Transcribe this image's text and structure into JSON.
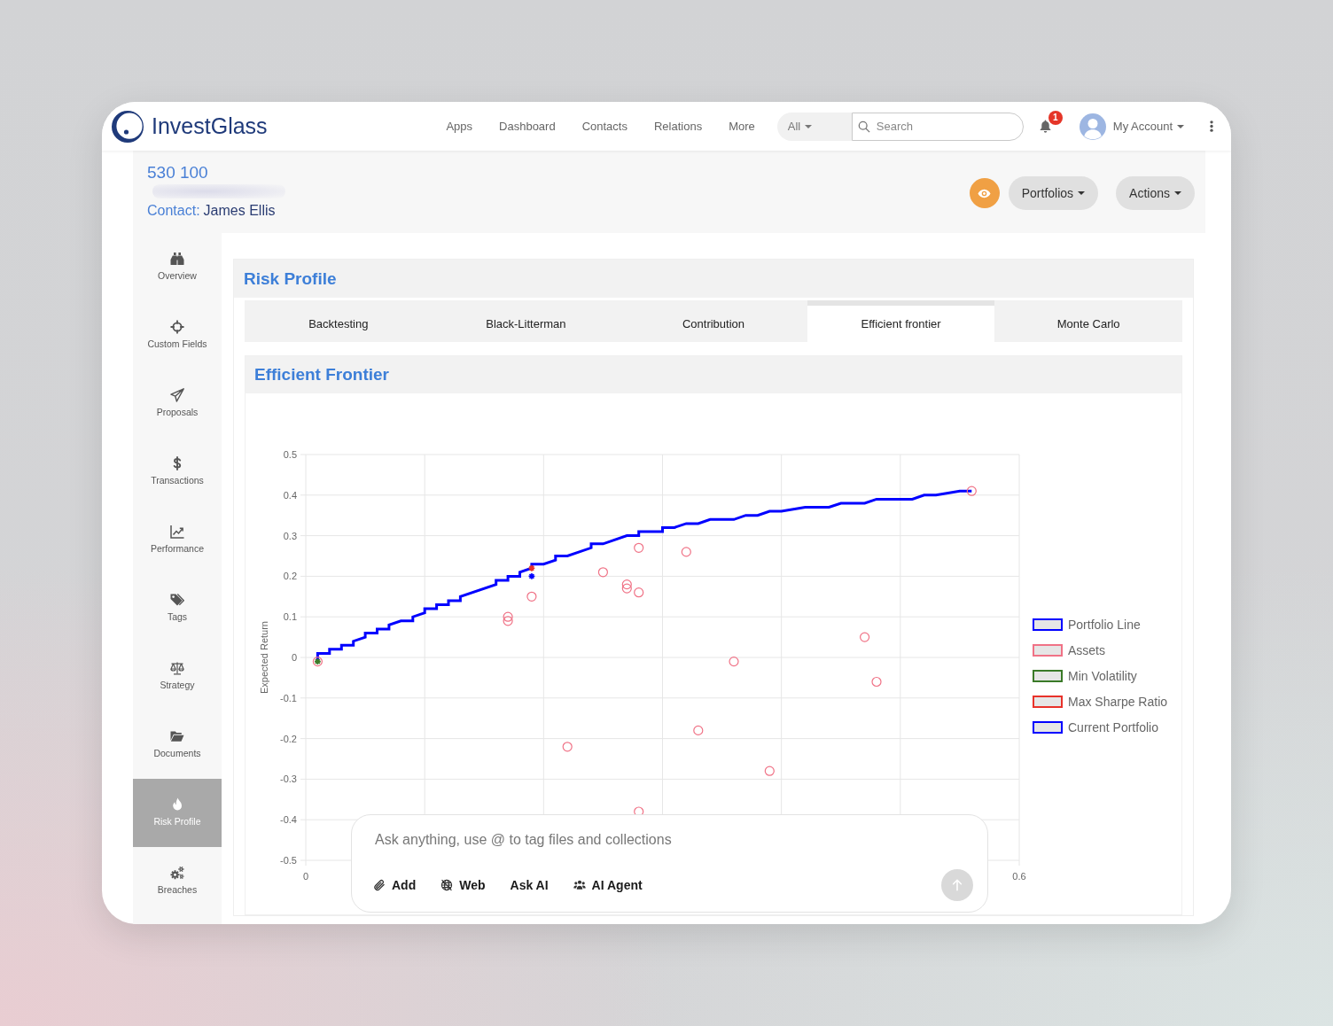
{
  "header": {
    "logo": "InvestGlass",
    "nav": [
      "Apps",
      "Dashboard",
      "Contacts",
      "Relations",
      "More"
    ],
    "search_scope": "All",
    "search": {
      "placeholder": "Search"
    },
    "notification_count": "1",
    "account": "My Account"
  },
  "record": {
    "title": "530 100",
    "contact_label": "Contact:",
    "contact_name": "James Ellis",
    "buttons": [
      "Portfolios",
      "Actions"
    ]
  },
  "sidebar": {
    "items": [
      {
        "label": "Overview",
        "selected": false
      },
      {
        "label": "Custom Fields",
        "selected": false
      },
      {
        "label": "Proposals",
        "selected": false
      },
      {
        "label": "Transactions",
        "selected": false
      },
      {
        "label": "Performance",
        "selected": false
      },
      {
        "label": "Tags",
        "selected": false
      },
      {
        "label": "Strategy",
        "selected": false
      },
      {
        "label": "Documents",
        "selected": false
      },
      {
        "label": "Risk Profile",
        "selected": true
      },
      {
        "label": "Breaches",
        "selected": false
      }
    ]
  },
  "card": {
    "title": "Risk Profile",
    "tabs": [
      {
        "label": "Backtesting",
        "selected": false
      },
      {
        "label": "Black-Litterman",
        "selected": false
      },
      {
        "label": "Contribution",
        "selected": false
      },
      {
        "label": "Efficient frontier",
        "selected": true
      },
      {
        "label": "Monte Carlo",
        "selected": false
      }
    ]
  },
  "frontier": {
    "title": "Efficient Frontier",
    "chart_data": {
      "type": "scatter",
      "ylabel": "Expected Return",
      "xlim": [
        0,
        0.6
      ],
      "ylim": [
        -0.5,
        0.5
      ],
      "xticks": [
        0,
        0.6
      ],
      "yticks": [
        0.5,
        0.4,
        0.3,
        0.2,
        0.1,
        0,
        -0.1,
        -0.2,
        -0.3,
        -0.4,
        -0.5
      ],
      "grid": true,
      "legend": "right",
      "series": [
        {
          "name": "Portfolio Line",
          "color": "#0000ff",
          "type": "line",
          "x": [
            0.01,
            0.01,
            0.02,
            0.02,
            0.03,
            0.03,
            0.04,
            0.04,
            0.05,
            0.05,
            0.06,
            0.06,
            0.07,
            0.07,
            0.08,
            0.09,
            0.09,
            0.1,
            0.1,
            0.11,
            0.11,
            0.12,
            0.12,
            0.13,
            0.13,
            0.16,
            0.16,
            0.17,
            0.17,
            0.18,
            0.18,
            0.19,
            0.19,
            0.2,
            0.21,
            0.21,
            0.22,
            0.24,
            0.24,
            0.25,
            0.27,
            0.28,
            0.28,
            0.3,
            0.3,
            0.31,
            0.32,
            0.33,
            0.34,
            0.36,
            0.37,
            0.38,
            0.39,
            0.4,
            0.42,
            0.44,
            0.45,
            0.47,
            0.48,
            0.51,
            0.52,
            0.53,
            0.55,
            0.56
          ],
          "values": [
            -0.01,
            0.01,
            0.01,
            0.02,
            0.02,
            0.03,
            0.03,
            0.04,
            0.05,
            0.06,
            0.06,
            0.07,
            0.07,
            0.08,
            0.09,
            0.09,
            0.1,
            0.11,
            0.12,
            0.12,
            0.13,
            0.13,
            0.14,
            0.14,
            0.15,
            0.18,
            0.19,
            0.19,
            0.2,
            0.2,
            0.21,
            0.22,
            0.23,
            0.23,
            0.24,
            0.25,
            0.25,
            0.27,
            0.28,
            0.28,
            0.3,
            0.3,
            0.31,
            0.31,
            0.32,
            0.32,
            0.33,
            0.33,
            0.34,
            0.34,
            0.35,
            0.35,
            0.36,
            0.36,
            0.37,
            0.37,
            0.38,
            0.38,
            0.39,
            0.39,
            0.4,
            0.4,
            0.41,
            0.41
          ]
        },
        {
          "name": "Assets",
          "color": "#f07286",
          "type": "scatter",
          "x": [
            0.01,
            0.56,
            0.28,
            0.32,
            0.25,
            0.27,
            0.27,
            0.28,
            0.19,
            0.17,
            0.17,
            0.47,
            0.36,
            0.48,
            0.33,
            0.22,
            0.39,
            0.28
          ],
          "values": [
            -0.01,
            0.41,
            0.27,
            0.26,
            0.21,
            0.18,
            0.17,
            0.16,
            0.15,
            0.1,
            0.09,
            0.05,
            -0.01,
            -0.06,
            -0.18,
            -0.22,
            -0.28,
            -0.38
          ]
        },
        {
          "name": "Min Volatility",
          "color": "#3a7a28",
          "type": "scatter",
          "x": [
            0.01
          ],
          "values": [
            -0.01
          ]
        },
        {
          "name": "Max Sharpe Ratio",
          "color": "#e8322a",
          "type": "scatter",
          "x": [
            0.19
          ],
          "values": [
            0.22
          ]
        },
        {
          "name": "Current Portfolio",
          "color": "#0000ff",
          "type": "scatter",
          "x": [
            0.19
          ],
          "values": [
            0.2
          ]
        }
      ]
    }
  },
  "composer": {
    "placeholder": "Ask anything, use @ to tag files and collections",
    "actions": [
      "Add",
      "Web",
      "Ask AI",
      "AI Agent"
    ]
  }
}
